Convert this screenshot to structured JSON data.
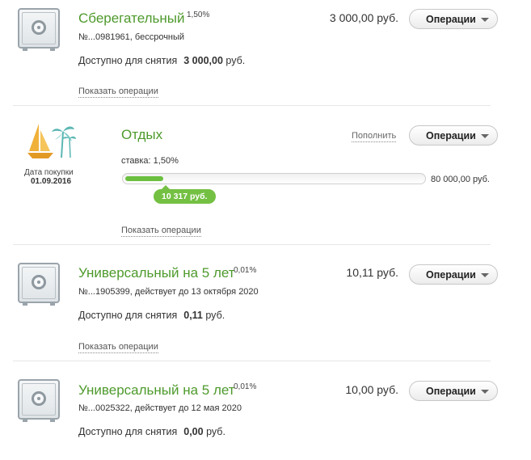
{
  "accounts": [
    {
      "title": "Сберегательный",
      "rate": "1,50%",
      "number": "№...0981961, бессрочный",
      "amount": "3 000,00 руб.",
      "available_label": "Доступно для снятия",
      "available_value": "3 000,00",
      "available_unit": "руб.",
      "ops_label": "Операции",
      "show_ops": "Показать операции",
      "icon": "safe-icon"
    },
    {
      "title": "Универсальный на 5 лет",
      "rate": "0,01%",
      "number": "№...1905399, действует до 13 октября 2020",
      "amount": "10,11 руб.",
      "available_label": "Доступно для снятия",
      "available_value": "0,11",
      "available_unit": "руб.",
      "ops_label": "Операции",
      "show_ops": "Показать операции",
      "icon": "safe-icon"
    },
    {
      "title": "Универсальный на 5 лет",
      "rate": "0,01%",
      "number": "№...0025322, действует до 12 мая 2020",
      "amount": "10,00 руб.",
      "available_label": "Доступно для снятия",
      "available_value": "0,00",
      "available_unit": "руб.",
      "ops_label": "Операции",
      "icon": "safe-icon"
    }
  ],
  "goal": {
    "title": "Отдых",
    "purchase_label": "Дата покупки",
    "purchase_date": "01.09.2016",
    "rate_text": "ставка: 1,50%",
    "refill_link": "Пополнить",
    "ops_label": "Операции",
    "current": "10 317 руб.",
    "target": "80 000,00 руб.",
    "progress_fraction": 0.129,
    "show_ops": "Показать операции",
    "icon": "sailboat-palm-icon"
  },
  "colors": {
    "title_green": "#4e9a2c",
    "progress_green": "#6abf3f",
    "boat_orange": "#f0b13a",
    "palm_teal": "#5bb7b3"
  }
}
